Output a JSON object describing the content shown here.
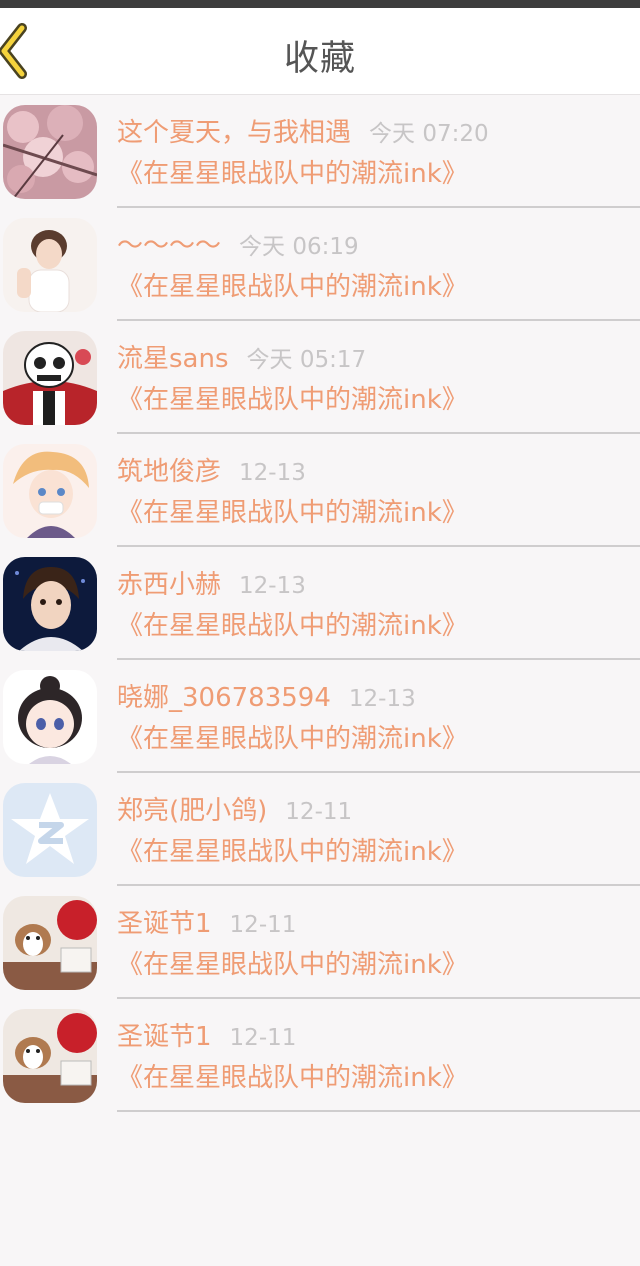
{
  "header": {
    "title": "收藏",
    "back_icon": "chevron-left-icon",
    "accent_color": "#f5d33c"
  },
  "colors": {
    "name": "#ef9c74",
    "subtitle": "#ef9c74",
    "time": "#c7c5c6",
    "background": "#f8f6f7"
  },
  "favorites": [
    {
      "name": "这个夏天，与我相遇",
      "time": "今天 07:20",
      "subtitle": "《在星星眼战队中的潮流ink》",
      "avatar": "cherry-blossom-avatar"
    },
    {
      "name": "～～～～",
      "time": "今天 06:19",
      "subtitle": "《在星星眼战队中的潮流ink》",
      "avatar": "girl-avatar"
    },
    {
      "name": "流星sans",
      "time": "今天 05:17",
      "subtitle": "《在星星眼战队中的潮流ink》",
      "avatar": "skeleton-avatar"
    },
    {
      "name": "筑地俊彦",
      "time": "12-13",
      "subtitle": "《在星星眼战队中的潮流ink》",
      "avatar": "anime-boy-avatar"
    },
    {
      "name": "赤西小赫",
      "time": "12-13",
      "subtitle": "《在星星眼战队中的潮流ink》",
      "avatar": "portrait-avatar"
    },
    {
      "name": "晓娜_306783594",
      "time": "12-13",
      "subtitle": "《在星星眼战队中的潮流ink》",
      "avatar": "chibi-girl-avatar"
    },
    {
      "name": "郑亮(肥小鸽)",
      "time": "12-11",
      "subtitle": "《在星星眼战队中的潮流ink》",
      "avatar": "qzone-star-avatar"
    },
    {
      "name": "圣诞节1",
      "time": "12-11",
      "subtitle": "《在星星眼战队中的潮流ink》",
      "avatar": "dog-avatar"
    },
    {
      "name": "圣诞节1",
      "time": "12-11",
      "subtitle": "《在星星眼战队中的潮流ink》",
      "avatar": "dog-avatar"
    }
  ]
}
